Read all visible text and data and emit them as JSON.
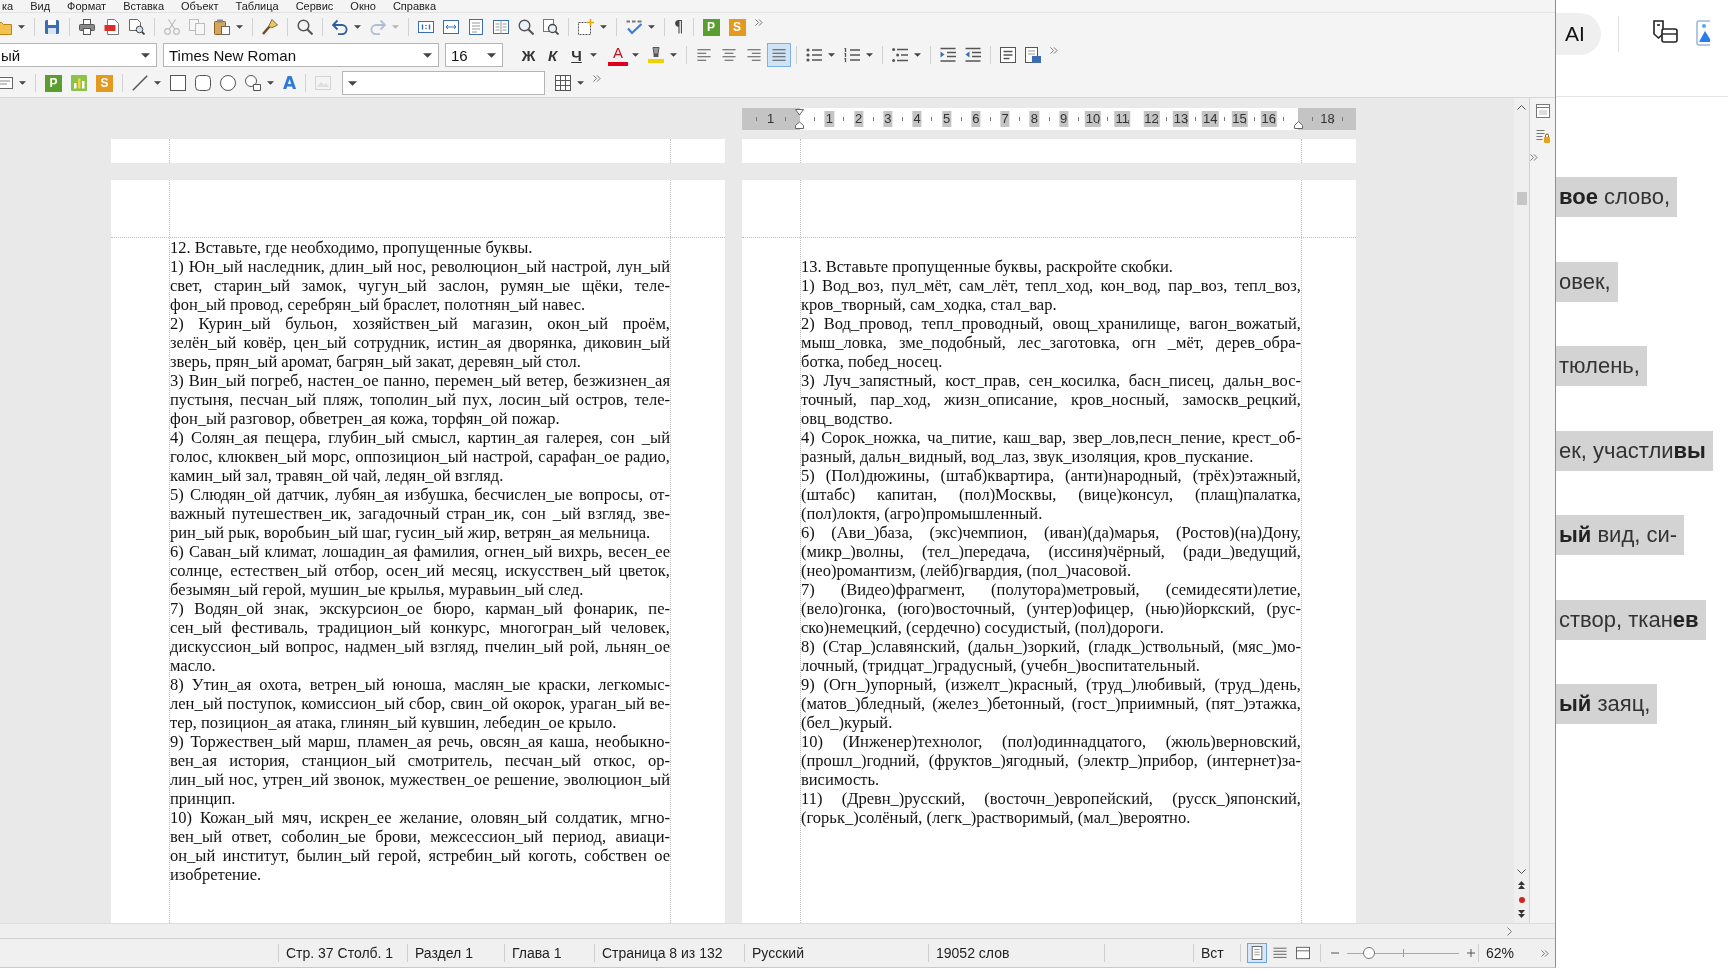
{
  "menu_bar": {
    "items": [
      "ка",
      "Вид",
      "Формат",
      "Вставка",
      "Объект",
      "Таблица",
      "Сервис",
      "Окно",
      "Справка"
    ]
  },
  "standard_toolbar": {
    "clipboard": [
      {
        "disabled": true
      },
      {
        "disabled": true
      },
      {
        "disabled": false
      }
    ],
    "history": [
      {
        "disabled": false
      },
      {
        "disabled": true
      }
    ],
    "formatting_marks": "¶",
    "letter_buttons": [
      "P",
      "S"
    ]
  },
  "formatting_toolbar": {
    "paragraph_style": "ый",
    "font_name": "Times New Roman",
    "font_size": "16",
    "character_buttons": [
      "Ж",
      "К",
      "Ч"
    ],
    "font_color_button": "A",
    "alignment": [
      {
        "selected": false
      },
      {
        "selected": false
      },
      {
        "selected": false
      },
      {
        "selected": true
      }
    ]
  },
  "drawing_toolbar": {
    "letter_buttons": [
      "P",
      "S"
    ],
    "fontwork_button": "A",
    "insert_image": {
      "disabled": true
    }
  },
  "ruler": {
    "labels": [
      "1",
      "1",
      "2",
      "3",
      "4",
      "5",
      "6",
      "7",
      "8",
      "9",
      "10",
      "11",
      "12",
      "13",
      "14",
      "15",
      "16",
      "18"
    ]
  },
  "pages": [
    {
      "heading": "12. Вставьте, где необходимо, пропущенные буквы.",
      "items": [
        "1) Юн_ый наследник, длин_ый нос, революцион_ый настрой, лун_ый свет, старин_ый замок, чугун_ый заслон, румян_ые щёки, теле-фон_ый провод, серебрян_ый браслет, полотнян_ый навес.",
        "2) Курин_ый бульон, хозяйствен_ый магазин, окон_ый проём, зелён_ый ковёр, цен_ый сотрудник, истин_ая дворянка, диковин_ый зверь, прян_ый аромат, багрян_ый закат, деревян_ый стол.",
        "3) Вин_ый погреб, настен_ое панно, перемен_ый ветер, безжизнен_ая пустыня, песчан_ый пляж, тополин_ый пух, лосин_ый остров, теле-фон_ый разговор, обветрен_ая кожа, торфян_ой пожар.",
        "4) Солян_ая пещера, глубин_ый смысл, картин_ая галерея, сон _ый голос, клюквен_ый морс, оппозицион_ый настрой, сарафан_ое радио, камин_ый зал, травян_ой чай, ледян_ой взгляд.",
        "5) Слюдян_ой датчик, лубян_ая избушка, бесчислен_ые вопросы, от-важный путешествен_ик, загадочный стран_ик, сон _ый взгляд, зве-рин_ый рык, воробьин_ый шаг, гусин_ый жир, ветрян_ая мельница.",
        "6) Саван_ый климат, лошадин_ая фамилия, огнен_ый вихрь, весен_ее солнце, естествен_ый отбор, осен_ий месяц, искусствен_ый цветок, безымян_ый герой, мушин_ые крылья, муравьин_ый след.",
        "7) Водян_ой знак, экскурсион_ое бюро, карман_ый фонарик, пе-сен_ый фестиваль, традицион_ый конкурс, многогран_ый человек, дискуссион_ый вопрос, надмен_ый взгляд, пчелин_ый рой, льнян_ое масло.",
        "8) Утин_ая охота, ветрен_ый юноша, маслян_ые краски, легкомыс-лен_ый поступок, комиссион_ый сбор, свин_ой окорок, ураган_ый ве-тер, позицион_ая атака, глинян_ый кувшин, лебедин_ое крыло.",
        "9) Торжествен_ый марш, пламен_ая речь, овсян_ая каша, необыкно-вен_ая история, станцион_ый смотритель, песчан_ый откос, ор-лин_ый нос, утрен_ий звонок, мужествен_ое решение, эволюцион_ый принцип.",
        "10) Кожан_ый мяч, искрен_ее желание, оловян_ый солдатик, мгно-вен_ый ответ, соболин_ые брови, межсессион_ый период, авиаци-он_ый институт, былин_ый герой, ястребин_ый коготь, собствен ое изобретение."
      ]
    },
    {
      "heading": "13. Вставьте пропущенные буквы, раскройте скобки.",
      "items": [
        "1) Вод_воз, пул_мёт, сам_лёт, тепл_ход, кон_вод, пар_воз, тепл_воз, кров_творный, сам_ходка, стал_вар.",
        "2) Вод_провод, тепл_проводный, овощ_хранилище, вагон_вожатый, мыш_ловка, зме_подобный, лес_заготовка, огн _мёт, дерев_обра-ботка, побед_носец.",
        "3) Луч_запястный, кост_прав, сен_косилка, басн_писец, дальн_вос-точный, пар_ход, жизн_описание, кров_носный, замоскв_рецкий, овц_водство.",
        "4) Сорок_ножка, ча_питие, каш_вар, звер_лов,песн_пение, крест_об-разный, дальн_видный, вод_лаз, звук_изоляция, кров_пускание.",
        "5) (Пол)дюжины, (штаб)квартира, (анти)народный, (трёх)этажный, (штабс) капитан, (пол)Москвы, (вице)консул, (плащ)палатка, (пол)локтя, (агро)промышленный.",
        "6) (Ави_)база, (экс)чемпион, (иван)(да)марья, (Ростов)(на)Дону, (микр_)волны, (тел_)передача, (иссиня)чёрный, (ради_)ведущий, (нео)романтизм, (лейб)гвардия, (пол_)часовой.",
        "7) (Видео)фрагмент, (полутора)метровый, (семидесяти)летие, (вело)гонка, (юго)восточный, (унтер)офицер, (нью)йоркский, (рус-ско)немецкий, (сердечно) сосудистый, (пол)дороги.",
        "8) (Стар_)славянский, (дальн_)зоркий, (гладк_)ствольный, (мяс_)мо-лочный, (тридцат_)градусный, (учебн_)воспитательный.",
        "9) (Огн_)упорный, (изжелт_)красный, (труд_)любивый, (труд_)день, (матов_)бледный, (желез_)бетонный, (гост_)приимный, (пят_)этажка, (бел_)курый.",
        "10) (Инженер)технолог, (пол)одиннадцатого, (жюль)верновский, (прошл_)годний, (фруктов_)ягодный, (электр_)прибор, (интернет)за-висимость.",
        "11) (Древн_)русский, (восточн_)европейский, (русск_)японский, (горьк_)солёный, (легк_)растворимый, (мал_)вероятно."
      ]
    }
  ],
  "status_bar": {
    "items": [
      "Стр. 37 Столб. 1",
      "Раздел 1",
      "Глава 1",
      "Страница 8 из 132",
      "Русский",
      "19052 слов",
      "Вст"
    ],
    "view_modes": [
      {
        "selected": true
      },
      {
        "selected": false
      },
      {
        "selected": false
      }
    ],
    "zoom": {
      "level": 0.2,
      "reading": "62%"
    }
  },
  "side_window": {
    "ai_button": "AI",
    "highlights": [
      "**вое** слово,",
      "овек,",
      "тюлень,",
      "ек, участли**вы**",
      "**ый** вид, си-",
      "створ, ткан**ев**",
      "**ый** заяц,"
    ]
  }
}
